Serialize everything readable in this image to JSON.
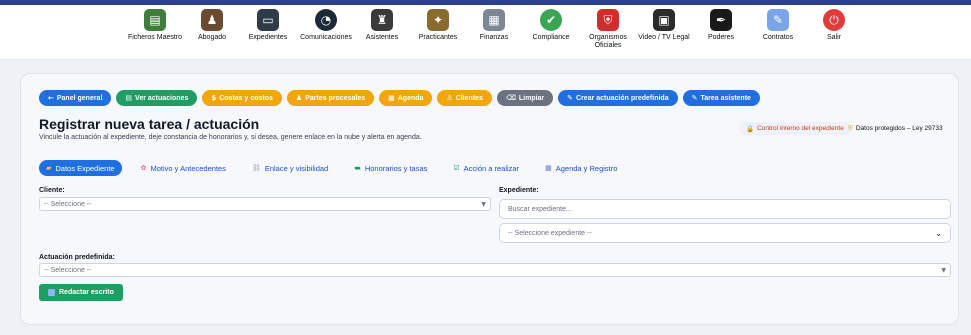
{
  "nav": {
    "items": [
      {
        "label": "Ficheros Maestro",
        "icon": "folder-tree-icon",
        "glyph": "▤",
        "color": "#3f7d3a"
      },
      {
        "label": "Abogado",
        "icon": "lawyer-icon",
        "glyph": "♟",
        "color": "#6b4a2f"
      },
      {
        "label": "Expedientes",
        "icon": "laptop-icon",
        "glyph": "▭",
        "color": "#2f3b46"
      },
      {
        "label": "Comunicaciones",
        "icon": "gauge-icon",
        "glyph": "◔",
        "color": "#1e2a3a"
      },
      {
        "label": "Asistentes",
        "icon": "assistants-icon",
        "glyph": "♜",
        "color": "#3a3a3a"
      },
      {
        "label": "Practicantes",
        "icon": "interns-icon",
        "glyph": "✦",
        "color": "#8a6b2f"
      },
      {
        "label": "Finanzas",
        "icon": "finance-icon",
        "glyph": "▦",
        "color": "#7b8794"
      },
      {
        "label": "Compliance",
        "icon": "check-circle-icon",
        "glyph": "✔",
        "color": "#3aa655"
      },
      {
        "label": "Organismos\nOficiales",
        "icon": "government-shield-icon",
        "glyph": "⛨",
        "color": "#d12d2d"
      },
      {
        "label": "Video / TV Legal",
        "icon": "tv-icon",
        "glyph": "▣",
        "color": "#2b2b2b"
      },
      {
        "label": "Poderes",
        "icon": "signature-pen-icon",
        "glyph": "✒",
        "color": "#1a1a1a"
      },
      {
        "label": "Contratos",
        "icon": "contract-icon",
        "glyph": "✎",
        "color": "#7aa5e8"
      },
      {
        "label": "Salir",
        "icon": "exit-icon",
        "glyph": "⏻",
        "color": "#e23b3b"
      }
    ]
  },
  "actions": [
    {
      "label": "Panel general",
      "icon": "←",
      "color": "blue"
    },
    {
      "label": "Ver actuaciones",
      "icon": "▤",
      "color": "green"
    },
    {
      "label": "Costas y costos",
      "icon": "$",
      "color": "orange"
    },
    {
      "label": "Partes procesales",
      "icon": "♟",
      "color": "orange"
    },
    {
      "label": "Agenda",
      "icon": "▦",
      "color": "orange"
    },
    {
      "label": "Clientes",
      "icon": "♙",
      "color": "orange"
    },
    {
      "label": "Limpiar",
      "icon": "⌫",
      "color": "gray"
    },
    {
      "label": "Crear actuación predefinida",
      "icon": "✎",
      "color": "blue"
    },
    {
      "label": "Tarea asistente",
      "icon": "✎",
      "color": "blue"
    }
  ],
  "header": {
    "title": "Registrar nueva tarea / actuación",
    "subtitle": "Vincule la actuación al expediente, deje constancia de honorarios y, si desea, genere enlace en la nube y alerta en agenda.",
    "badge_internal": "Control interno del expediente",
    "badge_privacy": "Datos protegidos – Ley 29733"
  },
  "tabs": [
    {
      "label": "Datos Expediente",
      "icon": "▰",
      "active": true
    },
    {
      "label": "Motivo y Antecedentes",
      "icon": "✿"
    },
    {
      "label": "Enlace y visibilidad",
      "icon": "⛓"
    },
    {
      "label": "Honorarios y tasas",
      "icon": "▬"
    },
    {
      "label": "Acción a realizar",
      "icon": "☑"
    },
    {
      "label": "Agenda y Registro",
      "icon": "▦"
    }
  ],
  "form": {
    "cliente_label": "Cliente:",
    "cliente_value": "-- Seleccione --",
    "expediente_label": "Expediente:",
    "expediente_search_placeholder": "Buscar expediente...",
    "expediente_select_value": "-- Seleccione expediente --",
    "actuacion_label": "Actuación predefinida:",
    "actuacion_value": "-- Seleccione --",
    "redactar_label": "Redactar escrito"
  }
}
